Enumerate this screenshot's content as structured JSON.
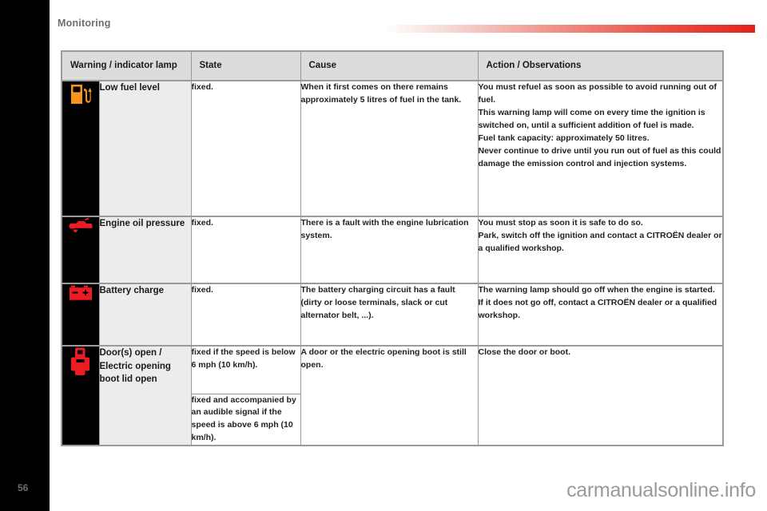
{
  "header": {
    "section_title": "Monitoring",
    "rule_color_start": "#ffffff",
    "rule_color_end": "#e2231f"
  },
  "table": {
    "columns": [
      "Warning / indicator lamp",
      "State",
      "Cause",
      "Action / Observations"
    ],
    "rows": [
      {
        "icon": "fuel-pump-icon",
        "icon_color": "#F7941E",
        "name": "Low fuel level",
        "state": "fixed.",
        "cause": "When it first comes on there remains approximately 5 litres of fuel in the tank.",
        "action": "You must refuel as soon as possible to avoid running out of fuel.\nThis warning lamp will come on every time the ignition is switched on, until a sufficient addition of fuel is made.\nFuel tank capacity: approximately 50 litres.\nNever continue to drive until you run out of fuel as this could damage the emission control and injection systems."
      },
      {
        "icon": "oil-can-icon",
        "icon_color": "#ED1C24",
        "name": "Engine oil pressure",
        "state": "fixed.",
        "cause": "There is a fault with the engine lubrication system.",
        "action": "You must stop as soon it is safe to do so.\nPark, switch off the ignition and contact a CITROËN dealer or a qualified workshop."
      },
      {
        "icon": "battery-icon",
        "icon_color": "#ED1C24",
        "name": "Battery charge",
        "state": "fixed.",
        "cause": "The battery charging circuit has a fault (dirty or loose terminals, slack or cut alternator belt, ...).",
        "action": "The warning lamp should go off when the engine is started.\nIf it does not go off, contact a CITROËN dealer or a qualified workshop."
      },
      {
        "icon": "door-open-icon",
        "icon_color": "#ED1C24",
        "name": "Door(s) open / Electric opening boot lid open",
        "state": "fixed if the speed is below 6 mph (10 km/h).",
        "state_secondary": "fixed and accompanied by an audible signal if the speed is above 6 mph (10 km/h).",
        "cause": "A door or the electric opening boot is still open.",
        "action": "Close the door or boot."
      }
    ]
  },
  "footer": {
    "page_number": "56",
    "watermark": "carmanualsonline.info"
  }
}
